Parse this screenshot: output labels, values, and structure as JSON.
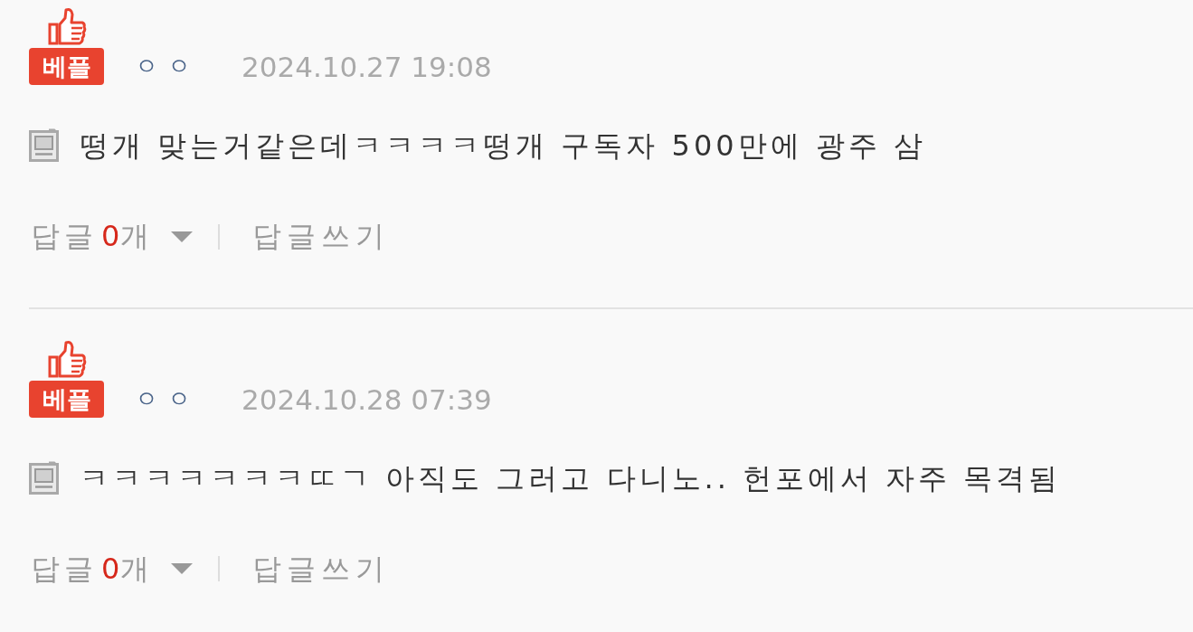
{
  "comments": [
    {
      "badge": {
        "label": "베플"
      },
      "author": "ㅇㅇ",
      "date": "2024.10.27 19:08",
      "text": "떵개 맞는거같은데ㅋㅋㅋㅋ떵개 구독자 500만에 광주 삼",
      "replies": {
        "label": "답글",
        "count": "0",
        "unit": "개",
        "expanded": false
      },
      "write_reply": "답글쓰기"
    },
    {
      "badge": {
        "label": "베플"
      },
      "author": "ㅇㅇ",
      "date": "2024.10.28 07:39",
      "text": "ㅋㅋㅋㅋㅋㅋㅋㄸㄱ 아직도 그러고 다니노.. 헌포에서 자주 목격됨",
      "replies": {
        "label": "답글",
        "count": "0",
        "unit": "개",
        "expanded": false
      },
      "write_reply": "답글쓰기"
    }
  ]
}
